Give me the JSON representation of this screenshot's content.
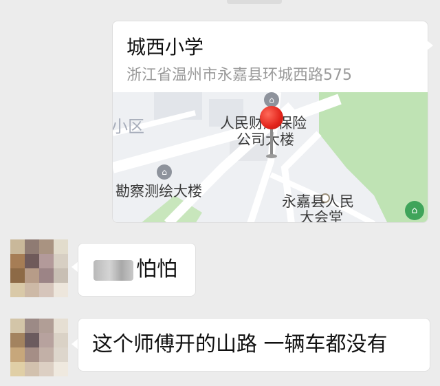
{
  "location_message": {
    "title": "城西小学",
    "address": "浙江省温州市永嘉县环城西路575",
    "map_labels": {
      "district": "小区",
      "insurance_line1": "人民财产保险",
      "insurance_line2": "公司大楼",
      "survey": "勘察测绘大楼",
      "hall_line1": "永嘉县人民",
      "hall_line2": "大会堂"
    },
    "pin_icon": "location-pin-icon",
    "accent_color": "#e2231a"
  },
  "messages": [
    {
      "text": "怕怕",
      "redacted_prefix": true,
      "avatar": "pixelated-avatar"
    },
    {
      "text": "这个师傅开的山路  一辆车都没有",
      "redacted_prefix": false,
      "avatar": "pixelated-avatar"
    }
  ]
}
